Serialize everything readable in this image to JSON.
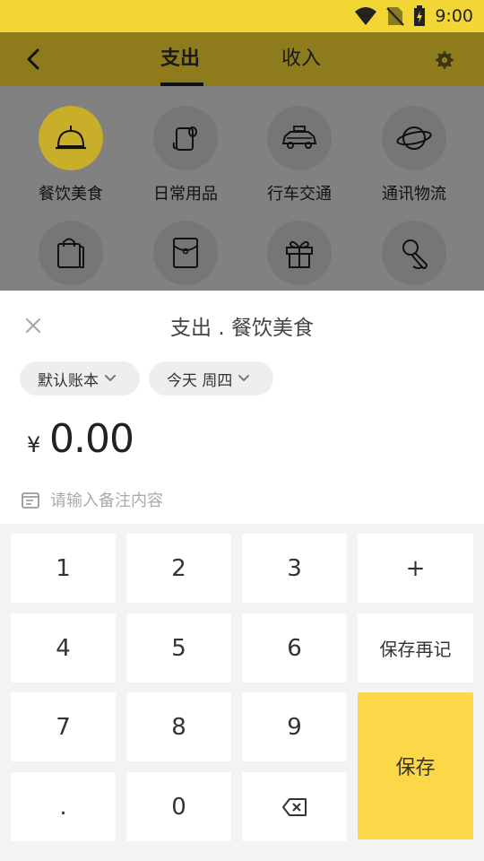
{
  "status_bar": {
    "time": "9:00"
  },
  "header": {
    "tabs": [
      {
        "label": "支出",
        "active": true
      },
      {
        "label": "收入",
        "active": false
      }
    ]
  },
  "categories": [
    {
      "label": "餐饮美食",
      "icon": "food-cloche-icon",
      "selected": true
    },
    {
      "label": "日常用品",
      "icon": "toilet-paper-icon",
      "selected": false
    },
    {
      "label": "行车交通",
      "icon": "taxi-icon",
      "selected": false
    },
    {
      "label": "通讯物流",
      "icon": "planet-icon",
      "selected": false
    },
    {
      "label": "",
      "icon": "shopping-bag-icon",
      "selected": false
    },
    {
      "label": "",
      "icon": "red-envelope-icon",
      "selected": false
    },
    {
      "label": "",
      "icon": "gift-icon",
      "selected": false
    },
    {
      "label": "",
      "icon": "microphone-icon",
      "selected": false
    }
  ],
  "sheet": {
    "title": "支出 . 餐饮美食",
    "account_chip": "默认账本",
    "date_chip": "今天 周四",
    "currency_symbol": "¥",
    "amount": "0.00",
    "note_placeholder": "请输入备注内容"
  },
  "keypad": {
    "keys": [
      "1",
      "2",
      "3",
      "+",
      "4",
      "5",
      "6",
      "保存再记",
      "7",
      "8",
      "9",
      ".",
      "0"
    ],
    "save_label": "保存"
  },
  "colors": {
    "accent_yellow": "#fcd848",
    "status_bar": "#f1d635",
    "header_dimmed": "#8e7c1c"
  }
}
